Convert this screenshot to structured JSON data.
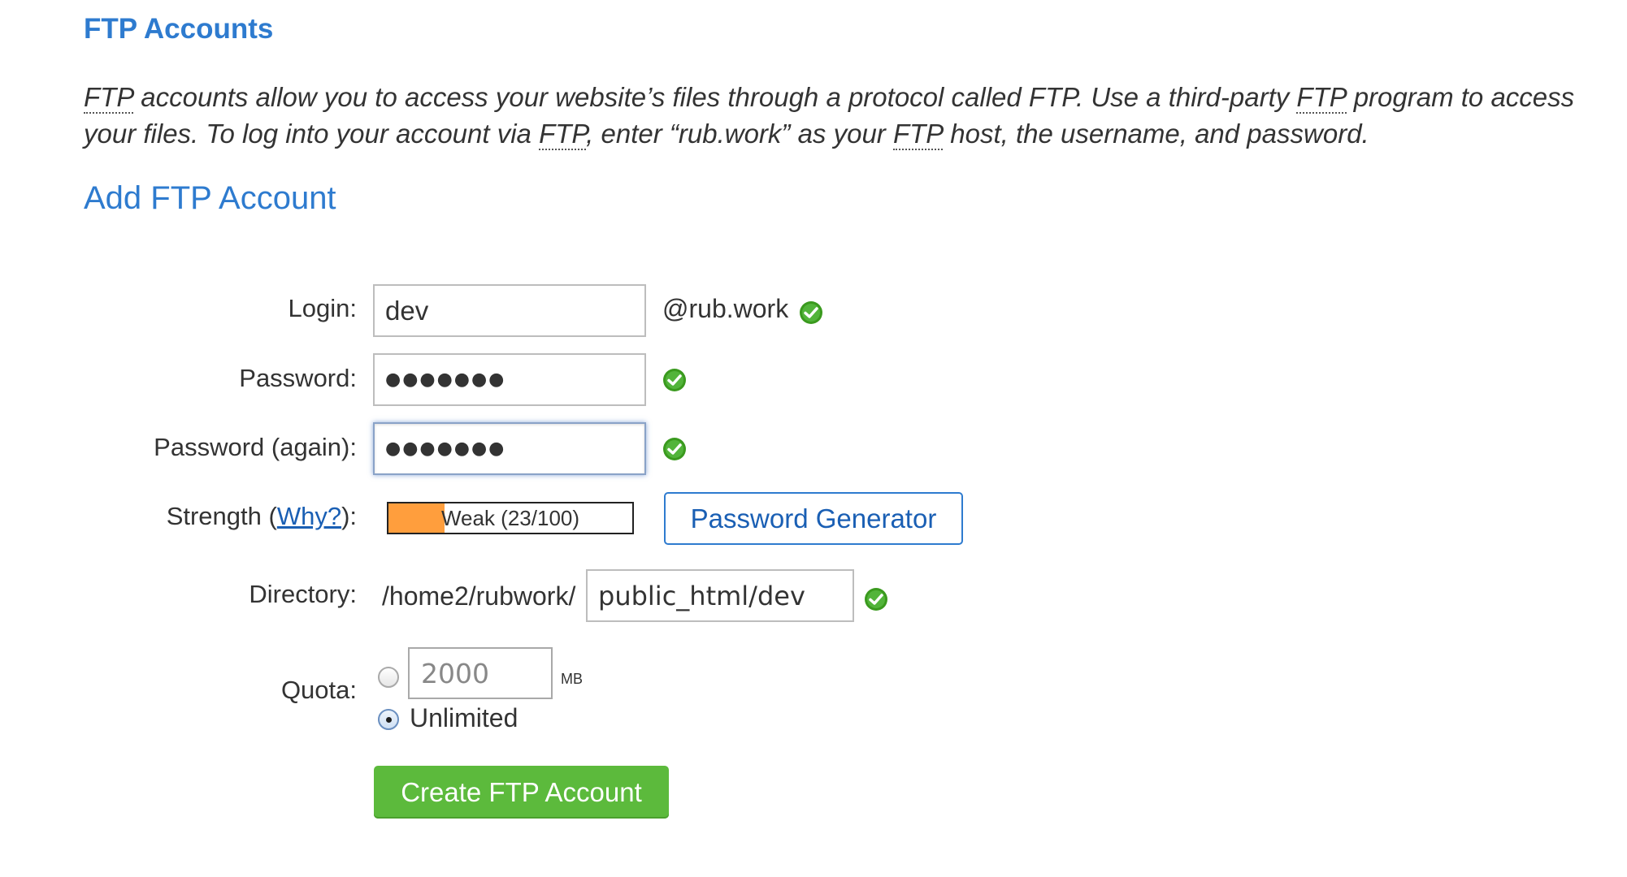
{
  "header": {
    "title": "FTP Accounts",
    "intro": {
      "abbr": "FTP",
      "p1": " accounts allow you to access your website’s files through a protocol called FTP. Use a third-party ",
      "p2": " program to access your files. To log into your account via ",
      "p3": ", enter “rub.work” as your ",
      "p4": " host, the username, and password."
    }
  },
  "add_form": {
    "title": "Add FTP Account",
    "login": {
      "label": "Login:",
      "value": "dev",
      "domain_suffix": "@rub.work"
    },
    "password": {
      "label": "Password:",
      "masked_value": "●●●●●●●"
    },
    "password_again": {
      "label": "Password (again):",
      "masked_value": "●●●●●●●"
    },
    "strength": {
      "label_prefix": "Strength (",
      "link": "Why?",
      "label_suffix": "):",
      "text": "Weak (23/100)",
      "score": 23,
      "max": 100,
      "fill_color": "#ff9e3d"
    },
    "generator_button": "Password Generator",
    "directory": {
      "label": "Directory:",
      "prefix": "/home2/rubwork/",
      "value": "public_html/dev"
    },
    "quota": {
      "label": "Quota:",
      "limit_value": "2000",
      "unit": "MB",
      "unlimited_label": "Unlimited",
      "selected": "unlimited"
    },
    "submit_button": "Create FTP Account"
  },
  "icons": {
    "valid": "check-circle-icon"
  },
  "colors": {
    "heading": "#2e7bcf",
    "primary_button": "#5cba3c",
    "valid_icon": "#3a9a1e"
  }
}
